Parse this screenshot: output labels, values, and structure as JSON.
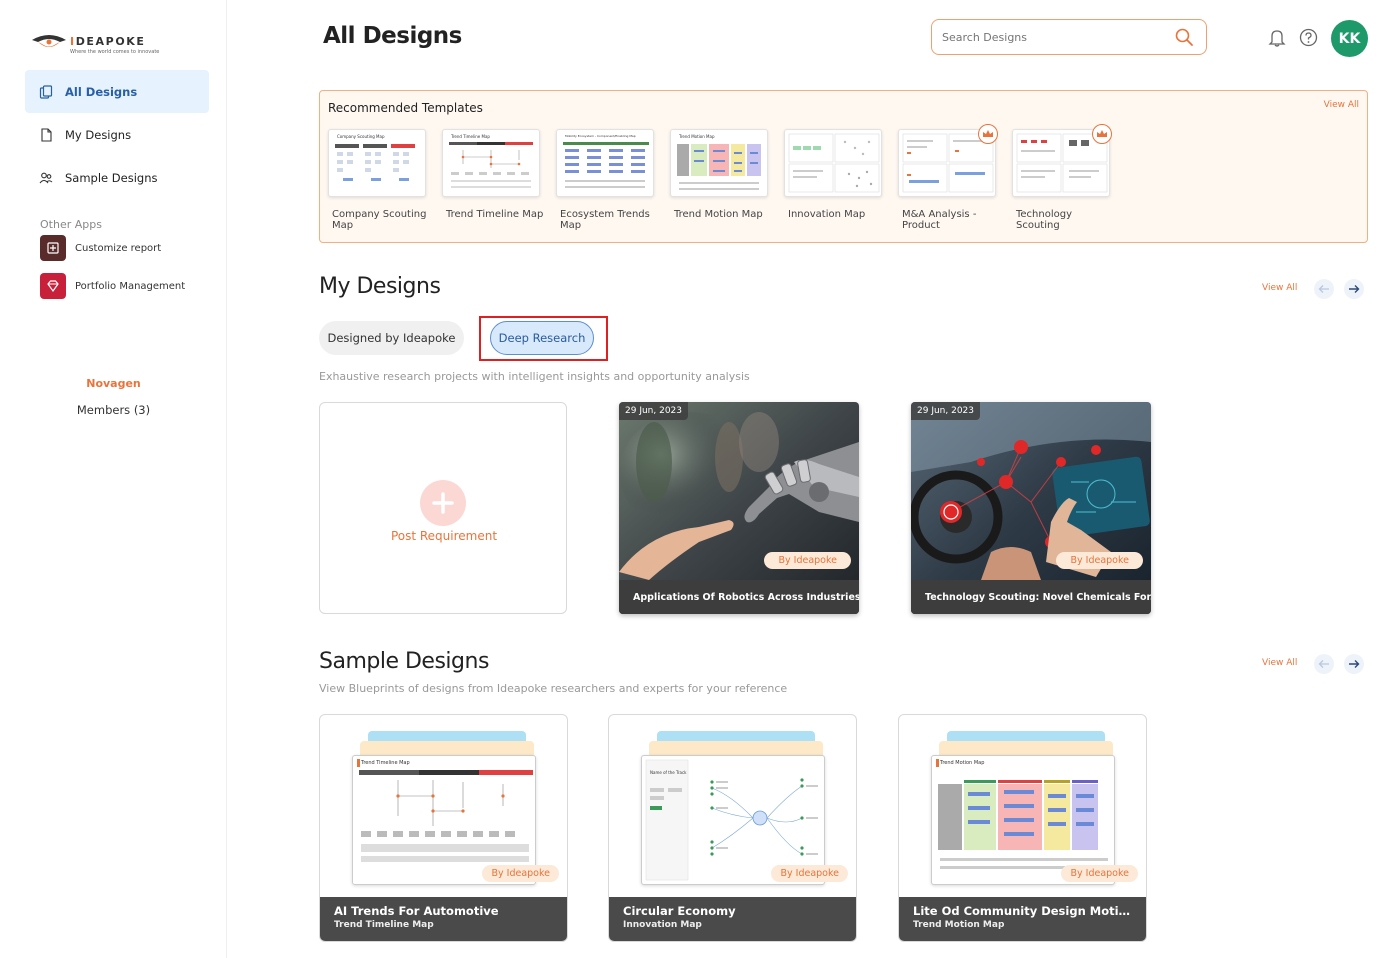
{
  "sidebar": {
    "logo": {
      "brand_prefix": "I",
      "brand_rest": "DEAPOKE",
      "tagline": "Where the world comes to innovate"
    },
    "nav": [
      {
        "label": "All Designs",
        "active": true
      },
      {
        "label": "My Designs",
        "active": false
      },
      {
        "label": "Sample Designs",
        "active": false
      }
    ],
    "other_apps_label": "Other Apps",
    "apps": [
      {
        "label": "Customize report"
      },
      {
        "label": "Portfolio Management"
      }
    ],
    "org_name": "Novagen",
    "members": "Members (3)"
  },
  "header": {
    "title": "All Designs",
    "search_placeholder": "Search Designs",
    "avatar_initials": "KK"
  },
  "recommended": {
    "title": "Recommended Templates",
    "view_all": "View All",
    "templates": [
      {
        "label": "Company Scouting Map",
        "thumb_title": "Company Scouting Map",
        "premium": false
      },
      {
        "label": "Trend Timeline Map",
        "thumb_title": "Trend Timeline Map",
        "premium": false
      },
      {
        "label": "Ecosystem Trends Map",
        "thumb_title": "Mobility Ecosystem - Component/Enabling Map",
        "premium": false
      },
      {
        "label": "Trend Motion Map",
        "thumb_title": "Trend Motion Map",
        "premium": false
      },
      {
        "label": "Innovation Map",
        "thumb_title": "",
        "premium": false
      },
      {
        "label": "M&A Analysis - Product",
        "thumb_title": "",
        "premium": true
      },
      {
        "label": "Technology Scouting",
        "thumb_title": "",
        "premium": true
      }
    ]
  },
  "my_designs": {
    "title": "My Designs",
    "view_all": "View All",
    "tabs": [
      {
        "label": "Designed by Ideapoke",
        "selected": false
      },
      {
        "label": "Deep Research",
        "selected": true
      }
    ],
    "subtitle": "Exhaustive research projects with intelligent insights and opportunity analysis",
    "post_label": "Post Requirement",
    "cards": [
      {
        "date": "29 Jun, 2023",
        "badge": "By Ideapoke",
        "title": "Applications Of Robotics Across Industries"
      },
      {
        "date": "29 Jun, 2023",
        "badge": "By Ideapoke",
        "title": "Technology Scouting: Novel Chemicals For..."
      }
    ]
  },
  "sample_designs": {
    "title": "Sample Designs",
    "view_all": "View All",
    "subtitle": "View Blueprints of designs from Ideapoke researchers and experts for your reference",
    "cards": [
      {
        "title": "AI Trends For Automotive",
        "subtitle": "Trend Timeline Map",
        "badge": "By Ideapoke",
        "doc_title": "Trend Timeline Map",
        "doc_sub": ""
      },
      {
        "title": "Circular Economy",
        "subtitle": "Innovation Map",
        "badge": "By Ideapoke",
        "doc_title": "",
        "doc_sub": "Name of the Track"
      },
      {
        "title": "Lite Od Community Design Motio...",
        "subtitle": "Trend Motion Map",
        "badge": "By Ideapoke",
        "doc_title": "Trend Motion Map",
        "doc_sub": ""
      }
    ]
  },
  "colors": {
    "accent": "#e8743b",
    "active_nav_bg": "#e6f2fd",
    "avatar": "#1e9a6a",
    "highlight": "#e02020"
  }
}
